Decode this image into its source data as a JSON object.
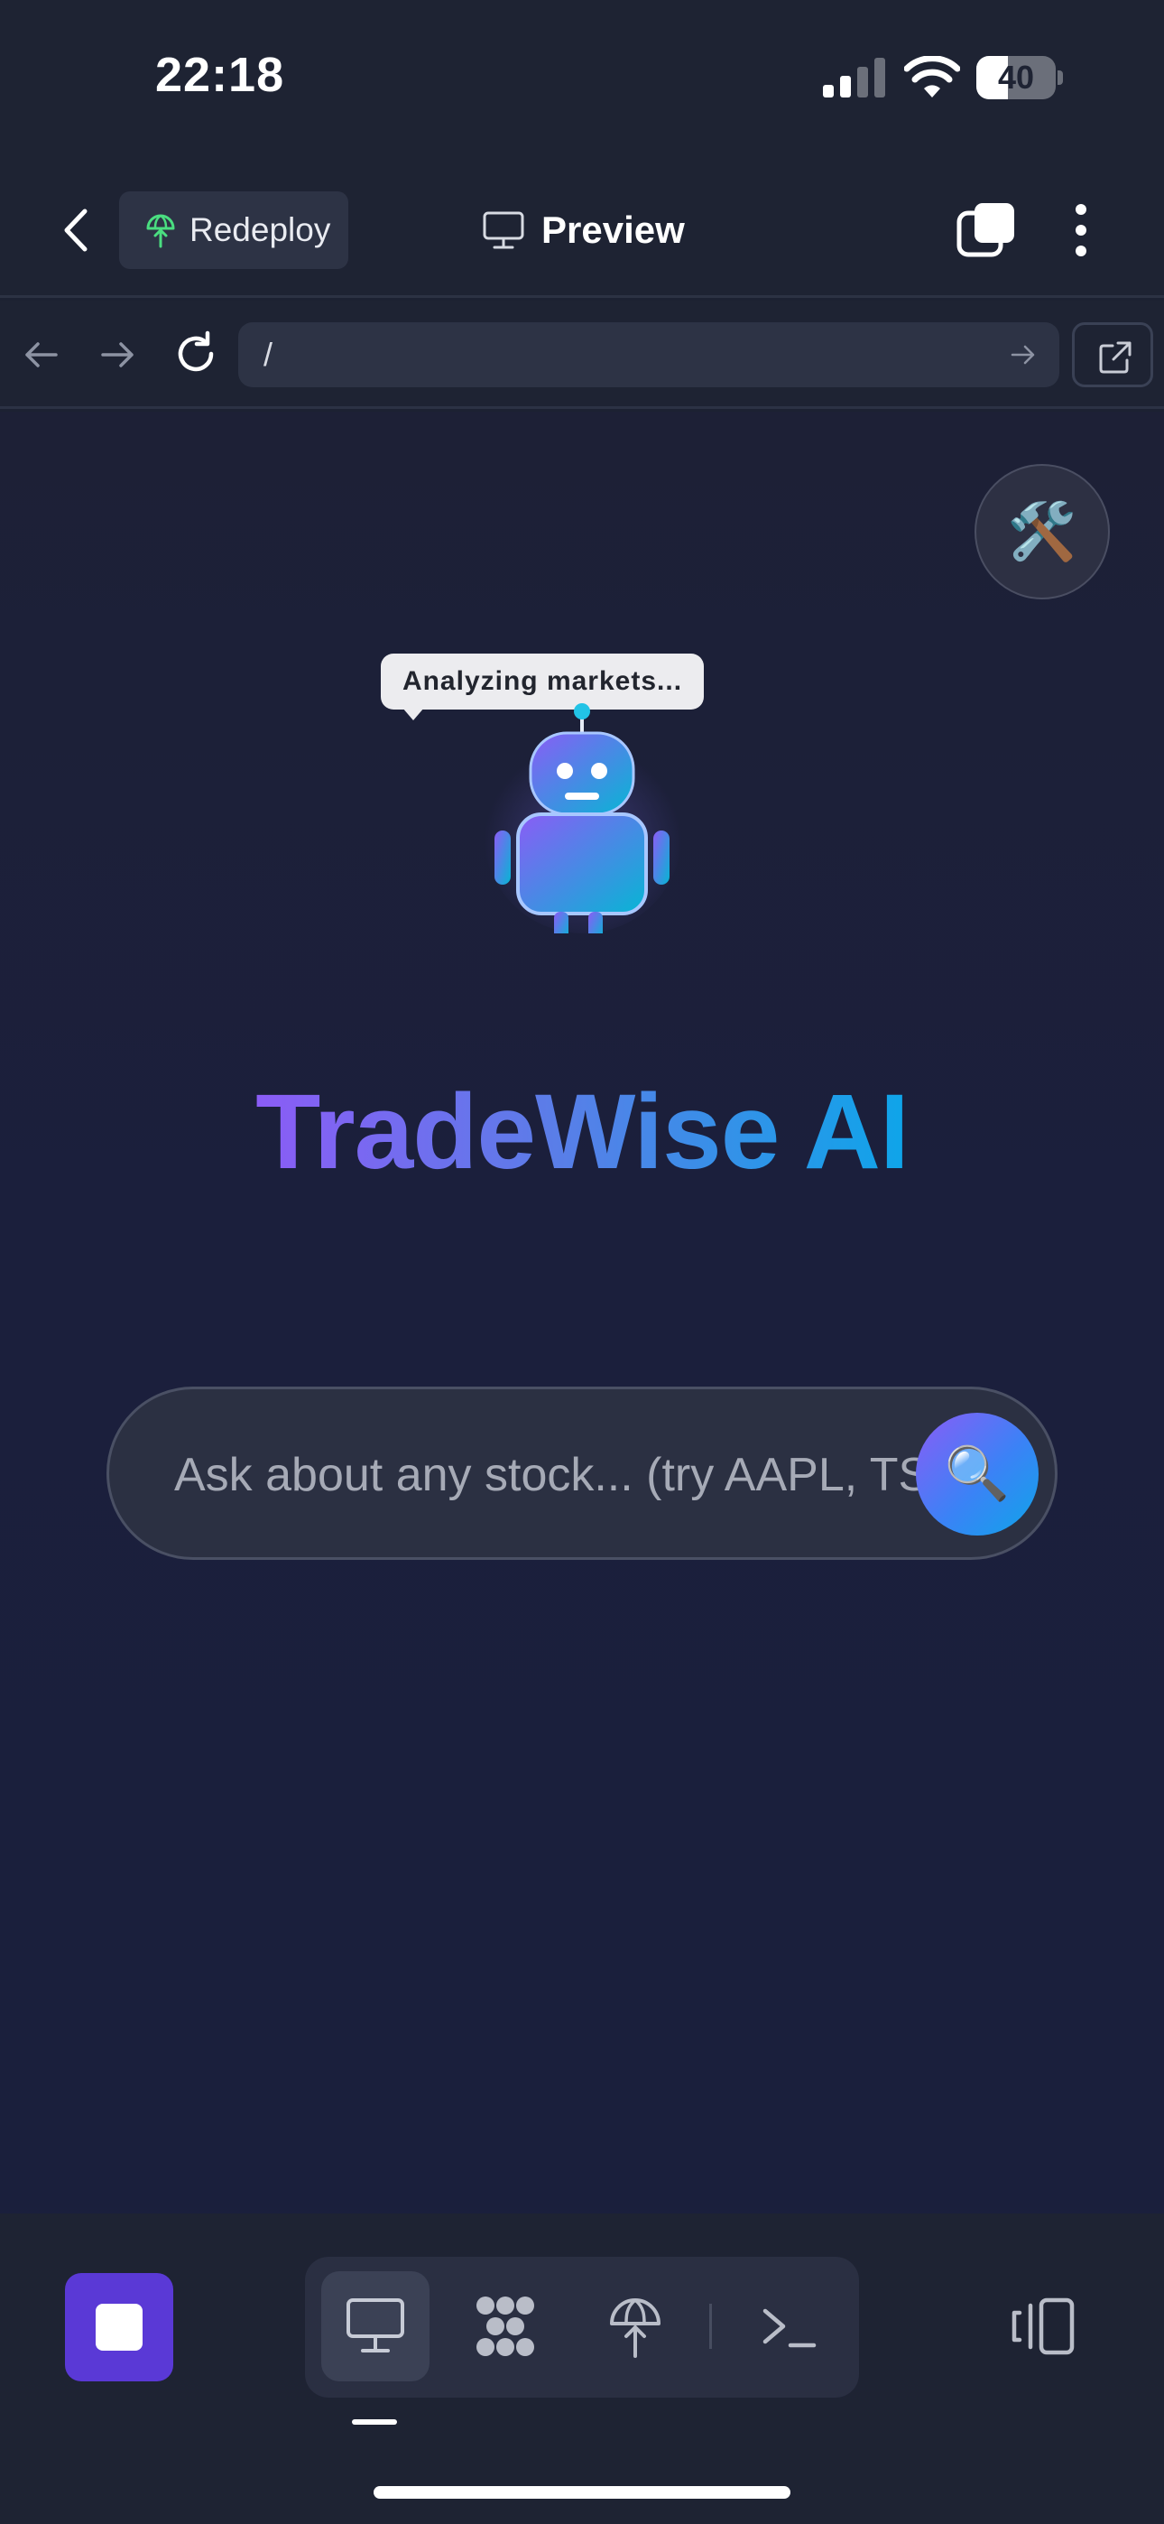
{
  "status_bar": {
    "time": "22:18",
    "battery_level": "40",
    "battery_fraction": 0.4
  },
  "header": {
    "back_icon": "chevron-left-icon",
    "redeploy_label": "Redeploy",
    "redeploy_icon": "deploy-globe-icon",
    "preview_label": "Preview",
    "preview_icon": "monitor-icon",
    "tabs_icon": "tabs-icon",
    "more_icon": "more-vertical-icon"
  },
  "url_bar": {
    "path": "/"
  },
  "page": {
    "tools_icon": "🛠️",
    "speech_bubble": "Analyzing markets...",
    "title": "TradeWise AI",
    "search": {
      "placeholder": "Ask about any stock... (try AAPL, TSLA)",
      "value": "",
      "button_icon": "🔍"
    }
  },
  "bottom_toolbar": {
    "stop_icon": "stop-icon",
    "tools": [
      {
        "name": "preview",
        "icon": "monitor-icon",
        "active": true
      },
      {
        "name": "agents",
        "icon": "network-icon",
        "active": false
      },
      {
        "name": "deploy",
        "icon": "deploy-globe-icon",
        "active": false
      },
      {
        "name": "shell",
        "icon": "terminal-icon",
        "active": false
      }
    ],
    "panel_icon": "panel-toggle-icon"
  },
  "colors": {
    "background": "#1c2132",
    "accent_purple": "#8b5cf6",
    "accent_blue": "#0ea5e9",
    "stop_button": "#5a39d6",
    "redeploy_icon": "#4ade80"
  }
}
